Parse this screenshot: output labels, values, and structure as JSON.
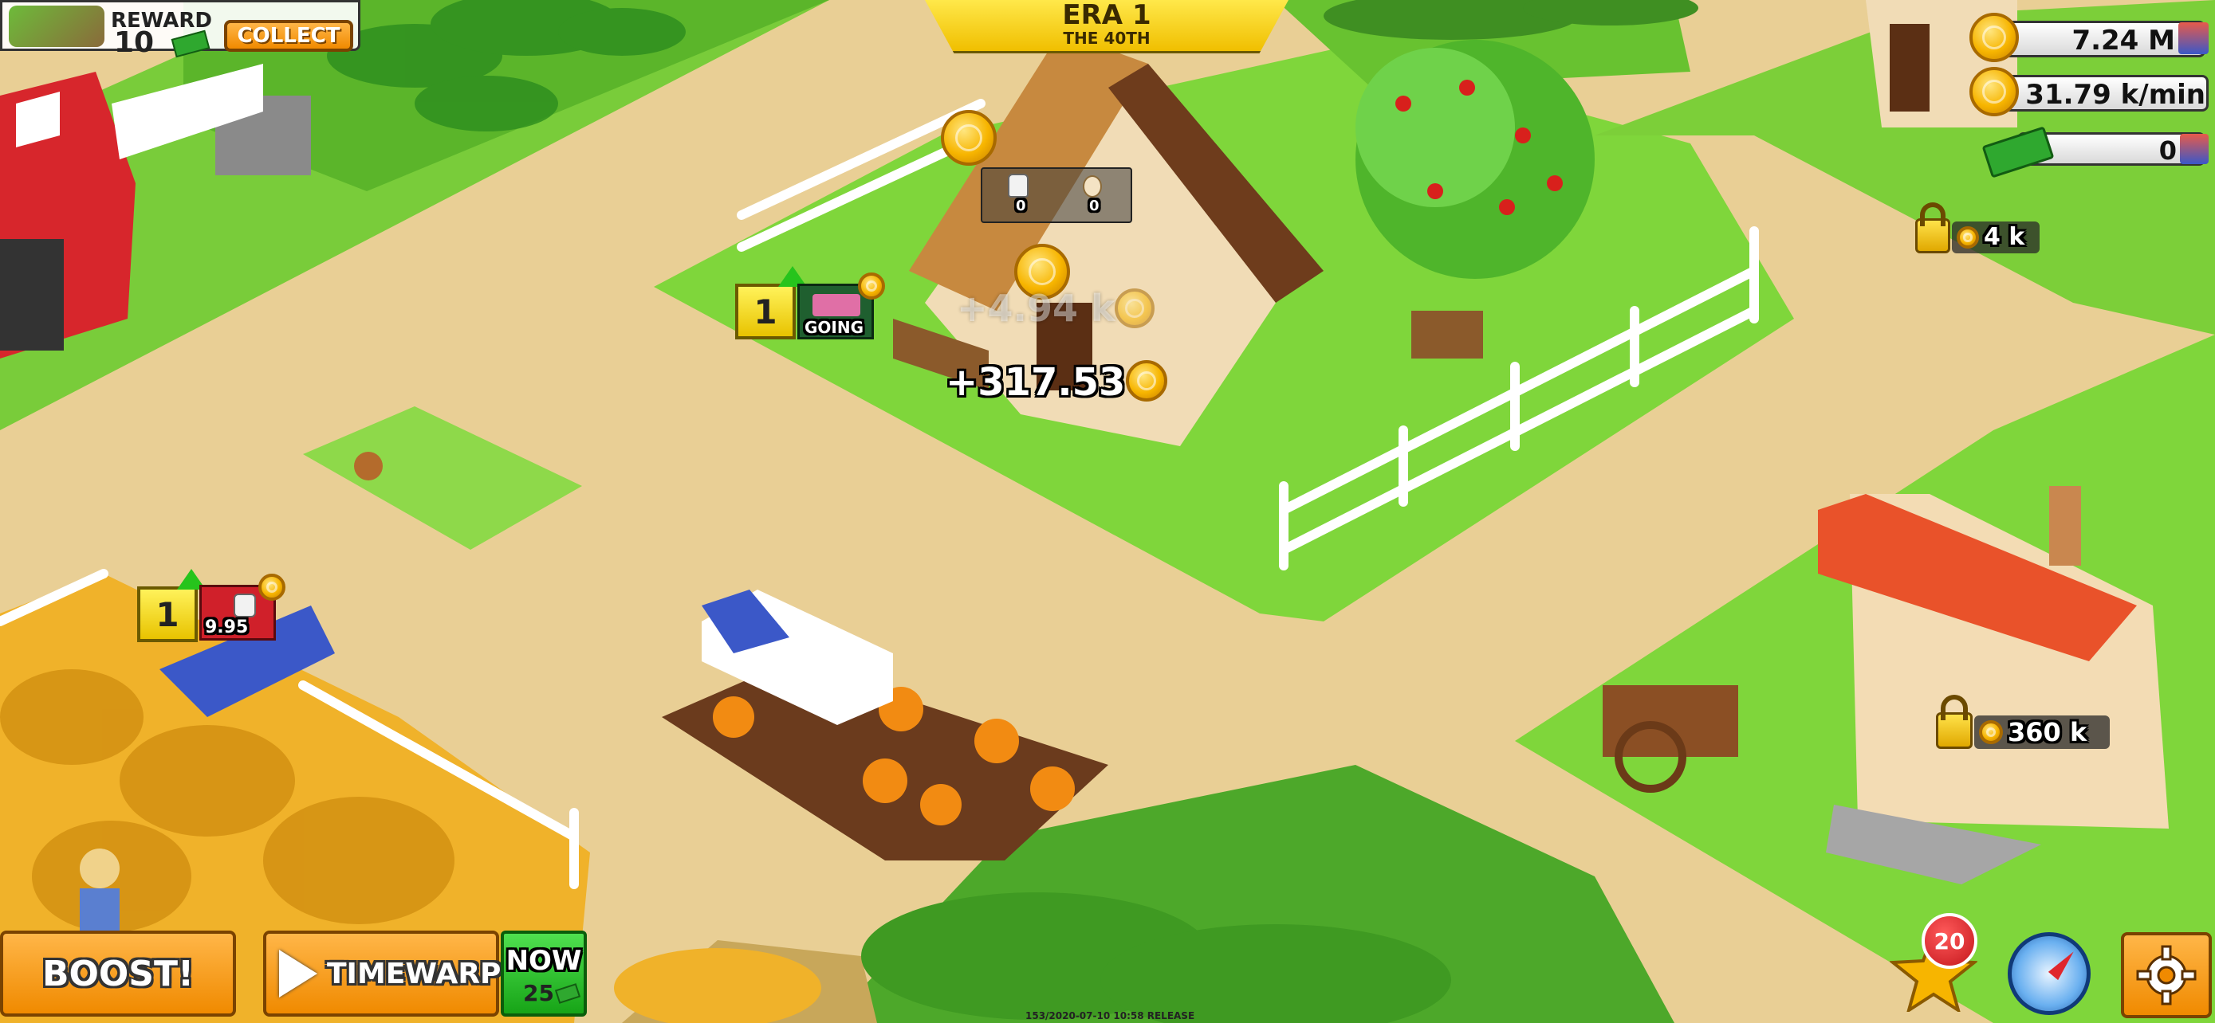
{
  "hud": {
    "reward": {
      "label": "REWARD",
      "amount": "10",
      "collect_label": "COLLECT"
    },
    "era": {
      "title": "ERA 1",
      "subtitle": "THE 40TH"
    },
    "resources": {
      "coins": "7.24 M",
      "rate": "31.79 k/min",
      "cash": "0"
    },
    "locks": {
      "upper_right": "4 k",
      "cottage": "360 k"
    }
  },
  "buildings": {
    "farmhouse": {
      "level": "1",
      "status": "GOING",
      "milk_count": "0",
      "egg_count": "0",
      "income_faded": "+4.94 k",
      "income": "+317.53"
    },
    "wheat_field": {
      "level": "1",
      "value": "9.95"
    }
  },
  "bottom_bar": {
    "boost_label": "BOOST!",
    "timewarp_label": "TIMEWARP!",
    "now_label": "NOW",
    "now_cost": "25",
    "notification_count": "20"
  },
  "build_stamp": "153/2020-07-10 10:58 RELEASE",
  "colors": {
    "dirt": "#e9cf95",
    "grass": "#7fd63b",
    "era_banner": "#f7d117",
    "button_orange": "#f7a21b",
    "now_green": "#1fbf1f",
    "level_yellow": "#f5e035",
    "badge_red": "#d0202a"
  }
}
